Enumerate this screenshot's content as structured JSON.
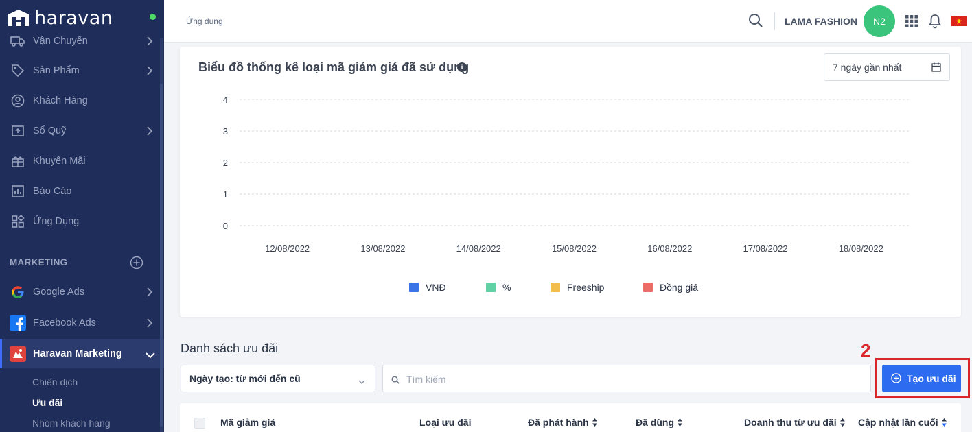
{
  "brand": {
    "name": "haravan"
  },
  "sidebar": {
    "items": [
      {
        "label": "Vận Chuyển",
        "icon": "truck-icon",
        "has_arrow": true
      },
      {
        "label": "Sản Phẩm",
        "icon": "tag-icon",
        "has_arrow": true
      },
      {
        "label": "Khách Hàng",
        "icon": "user-circle-icon",
        "has_arrow": false
      },
      {
        "label": "Sổ Quỹ",
        "icon": "cashbook-icon",
        "has_arrow": true
      },
      {
        "label": "Khuyến Mãi",
        "icon": "gift-icon",
        "has_arrow": false
      },
      {
        "label": "Báo Cáo",
        "icon": "bar-chart-icon",
        "has_arrow": false
      },
      {
        "label": "Ứng Dụng",
        "icon": "apps-icon",
        "has_arrow": false
      }
    ],
    "marketing_section": "MARKETING",
    "marketing_items": [
      {
        "label": "Google Ads",
        "icon": "google-icon"
      },
      {
        "label": "Facebook Ads",
        "icon": "facebook-icon"
      },
      {
        "label": "Haravan Marketing",
        "icon": "haravan-marketing-icon"
      }
    ],
    "sub_items": [
      "Chiến dịch",
      "Ưu đãi",
      "Nhóm khách hàng"
    ],
    "active_sub": "Ưu đãi"
  },
  "header": {
    "breadcrumb": "Ứng dụng",
    "shop_name": "LAMA FASHION",
    "avatar_initials": "N2"
  },
  "chart_card": {
    "title": "Biểu đồ thống kê loại mã giảm giá đã sử dụng",
    "date_range": "7 ngày gần nhất"
  },
  "chart_data": {
    "type": "bar",
    "categories": [
      "12/08/2022",
      "13/08/2022",
      "14/08/2022",
      "15/08/2022",
      "16/08/2022",
      "17/08/2022",
      "18/08/2022"
    ],
    "series": [
      {
        "name": "VNĐ",
        "color": "#3a74e6",
        "values": [
          0,
          0,
          0,
          0,
          0,
          0,
          0
        ]
      },
      {
        "name": "%",
        "color": "#5fd1a4",
        "values": [
          0,
          0,
          0,
          0,
          0,
          0,
          0
        ]
      },
      {
        "name": "Freeship",
        "color": "#f2bd4b",
        "values": [
          0,
          0,
          0,
          0,
          0,
          0,
          0
        ]
      },
      {
        "name": "Đồng giá",
        "color": "#ec6b6b",
        "values": [
          0,
          0,
          0,
          0,
          0,
          0,
          0
        ]
      }
    ],
    "yticks": [
      "0",
      "1",
      "2",
      "3",
      "4"
    ],
    "ylim": [
      0,
      4
    ],
    "grid": true,
    "legend": "bottom"
  },
  "list": {
    "title": "Danh sách ưu đãi",
    "step_number": "2",
    "sort_value": "Ngày tạo: từ mới đến cũ",
    "search_placeholder": "Tìm kiếm",
    "create_label": "Tạo ưu đãi",
    "columns": [
      "Mã giảm giá",
      "Loại ưu đãi",
      "Đã phát hành",
      "Đã dùng",
      "Doanh thu từ ưu đãi",
      "Cập nhật lần cuối"
    ]
  },
  "colors": {
    "sidebar_bg": "#1f2d5a",
    "primary": "#2d6cf0",
    "highlight": "#d9262b",
    "avatar": "#3bc57c"
  }
}
